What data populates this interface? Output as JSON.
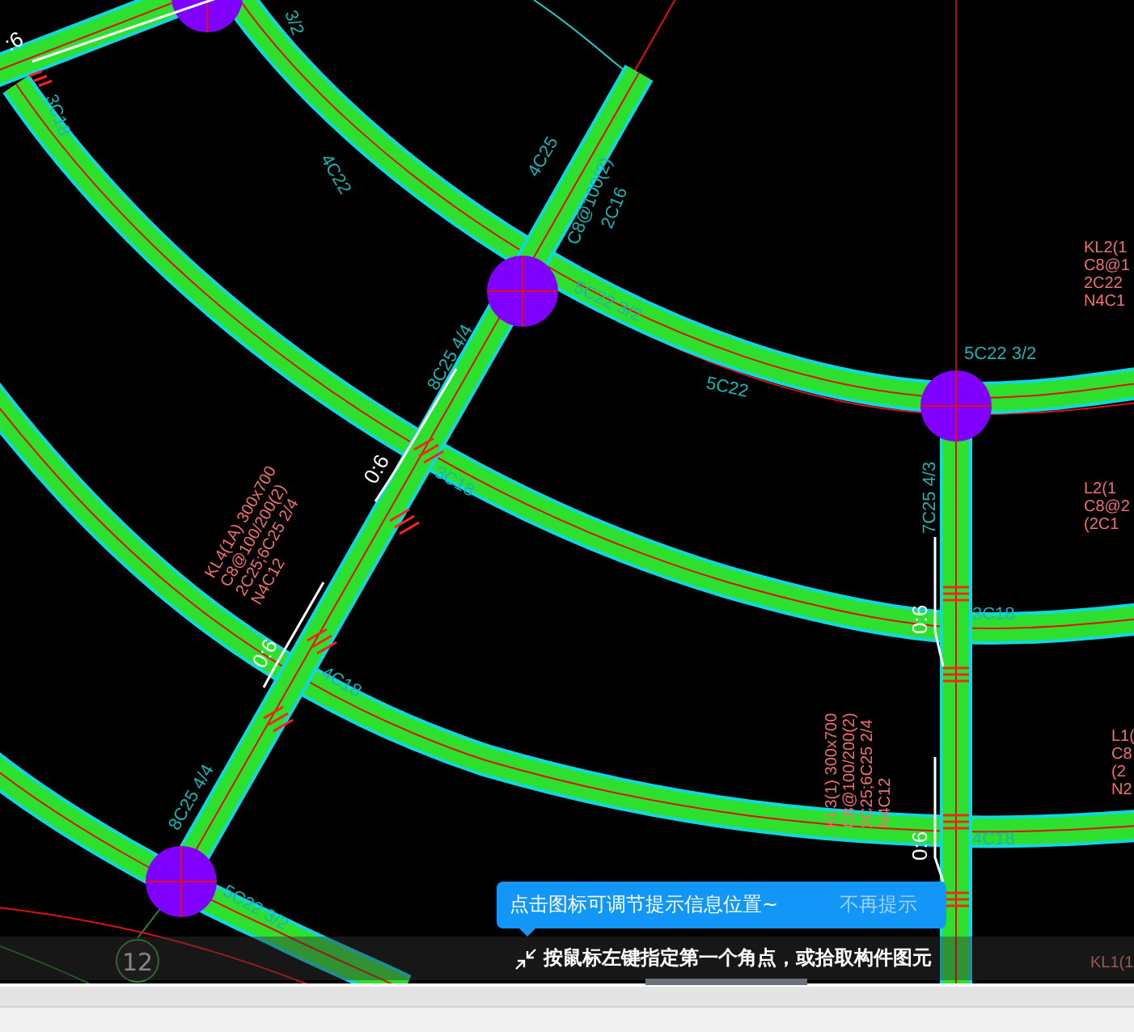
{
  "canvas": {
    "labels": [
      {
        "kind": "dimension",
        "text": ":6"
      },
      {
        "kind": "rebar",
        "text": "3C18"
      },
      {
        "kind": "rebar",
        "text": "4C22"
      },
      {
        "kind": "rebar",
        "text": "4C25"
      },
      {
        "kind": "rebar",
        "text": "3/2"
      },
      {
        "kind": "rebar",
        "text": "2C16"
      },
      {
        "kind": "rebar",
        "text": "C8@100(2)"
      },
      {
        "kind": "rebar",
        "text": "5C22 3/2"
      },
      {
        "kind": "rebar",
        "text": "5C22 3/2"
      },
      {
        "kind": "rebar",
        "text": "5C22"
      },
      {
        "kind": "rebar",
        "text": "8C25 4/4"
      },
      {
        "kind": "dimension",
        "text": "0:6"
      },
      {
        "kind": "rebar",
        "text": "3C18"
      },
      {
        "kind": "dimension",
        "text": "0:6"
      },
      {
        "kind": "rebar",
        "text": "4C18"
      },
      {
        "kind": "rebar",
        "text": "8C25 4/4"
      },
      {
        "kind": "rebar",
        "text": "5C22 3/2"
      },
      {
        "kind": "rebar",
        "text": "7C25 4/3"
      },
      {
        "kind": "dimension",
        "text": "0:6"
      },
      {
        "kind": "rebar",
        "text": "3C18"
      },
      {
        "kind": "dimension",
        "text": "0:6"
      },
      {
        "kind": "rebar",
        "text": "4C18"
      }
    ],
    "annotations": [
      {
        "lines": [
          "KL4(1A) 300x700",
          "C8@100/200(2)",
          "2C25;6C25 2/4",
          "N4C12"
        ]
      },
      {
        "lines": [
          "KL3(1) 300x700",
          "C8@100/200(2)",
          "2C25;6C25 2/4",
          "N4C12"
        ]
      },
      {
        "lines": [
          "KL2(1",
          "C8@1",
          "2C22",
          "N4C1"
        ]
      },
      {
        "lines": [
          "L2(1",
          "C8@2",
          "(2C1"
        ]
      },
      {
        "lines": [
          "L1(",
          "C8",
          "(2",
          "N2"
        ]
      },
      {
        "lines": [
          "KL1(1"
        ]
      }
    ],
    "axis_marker": {
      "text": "12"
    }
  },
  "tooltip": {
    "message": "点击图标可调节提示信息位置~",
    "dismiss": "不再提示"
  },
  "status_bar": {
    "prompt": "按鼠标左键指定第一个角点，或拾取构件图元"
  }
}
